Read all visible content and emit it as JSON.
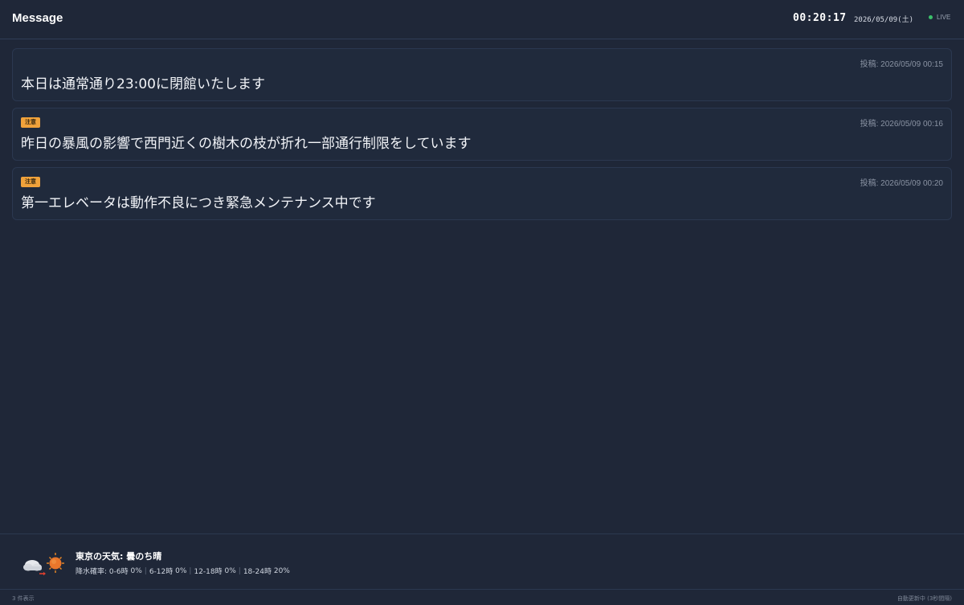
{
  "header": {
    "title": "Message",
    "clock": "00:20:17",
    "date": "2026/05/09(土)",
    "live_label": "LIVE",
    "live_color": "#3bbf6a"
  },
  "messages": [
    {
      "badge": "",
      "posted": "投稿: 2026/05/09 00:15",
      "text": "本日は通常通り23:00に閉館いたします"
    },
    {
      "badge": "注意",
      "posted": "投稿: 2026/05/09 00:16",
      "text": "昨日の暴風の影響で西門近くの樹木の枝が折れ一部通行制限をしています"
    },
    {
      "badge": "注意",
      "posted": "投稿: 2026/05/09 00:20",
      "text": "第一エレベータは動作不良につき緊急メンテナンス中です"
    }
  ],
  "weather": {
    "icon": "cloud-then-sun-icon",
    "title": "東京の天気: 曇のち晴",
    "rain_label": "降水確率:",
    "periods": [
      {
        "label": "0-6時",
        "value": "0%"
      },
      {
        "label": "6-12時",
        "value": "0%"
      },
      {
        "label": "12-18時",
        "value": "0%"
      },
      {
        "label": "18-24時",
        "value": "20%"
      }
    ]
  },
  "status": {
    "count": "3 件表示",
    "auto_update": "自動更新中 (3秒間隔)"
  },
  "colors": {
    "background": "#1f2738",
    "badge": "#f0a23b"
  }
}
